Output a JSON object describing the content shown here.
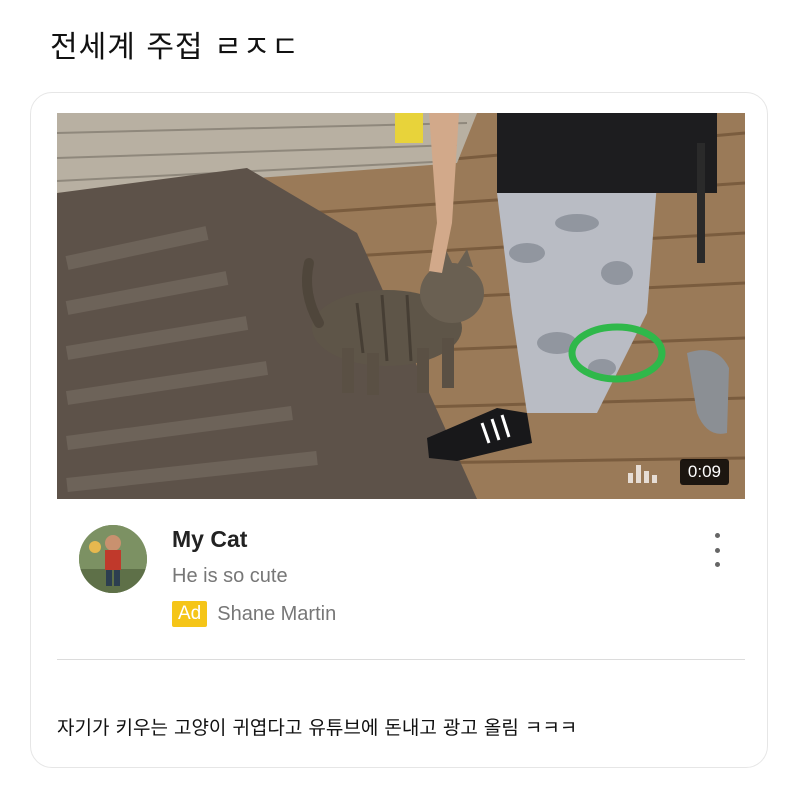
{
  "post": {
    "title": "전세계 주접 ㄹㅈㄷ",
    "caption": "자기가 키우는 고양이 귀엽다고 유튜브에 돈내고 광고 올림 ㅋㅋㅋ"
  },
  "video": {
    "duration": "0:09",
    "title": "My Cat",
    "description": "He is so cute",
    "ad_label": "Ad",
    "channel": "Shane Martin",
    "ad_color": "#f5c518"
  },
  "icons": {
    "more": "more-vertical-icon",
    "bars": "audio-bars-icon"
  }
}
